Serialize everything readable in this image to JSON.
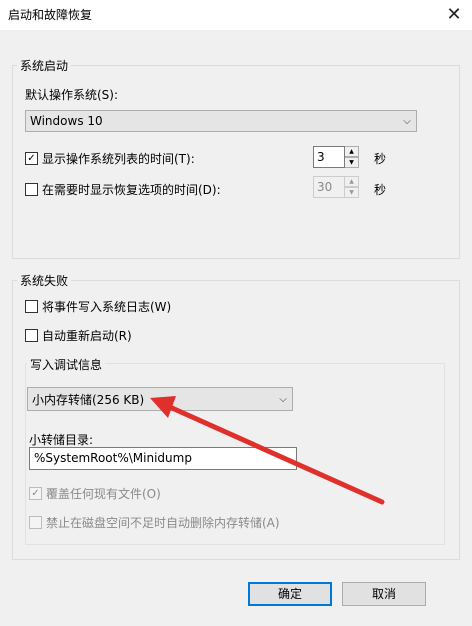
{
  "window": {
    "title": "启动和故障恢复",
    "close_glyph": "✕"
  },
  "system_startup": {
    "legend": "系统启动",
    "default_os_label": "默认操作系统(S):",
    "default_os_value": "Windows 10",
    "show_os_list": {
      "label": "显示操作系统列表的时间(T):",
      "checked": true,
      "value": "3",
      "unit": "秒"
    },
    "show_recovery": {
      "label": "在需要时显示恢复选项的时间(D):",
      "checked": false,
      "value": "30",
      "unit": "秒"
    }
  },
  "system_failure": {
    "legend": "系统失败",
    "write_event_log": {
      "label": "将事件写入系统日志(W)",
      "checked": false
    },
    "auto_restart": {
      "label": "自动重新启动(R)",
      "checked": false
    },
    "debug_info": {
      "legend": "写入调试信息",
      "dump_type": "小内存转储(256 KB)",
      "dump_dir_label": "小转储目录:",
      "dump_dir_value": "%SystemRoot%\\Minidump",
      "overwrite": {
        "label": "覆盖任何现有文件(O)",
        "checked": true
      },
      "disable_auto_delete": {
        "label": "禁止在磁盘空间不足时自动删除内存转储(A)",
        "checked": false
      }
    }
  },
  "buttons": {
    "ok": "确定",
    "cancel": "取消"
  },
  "glyphs": {
    "check": "✓",
    "combo_arrow": "⌵",
    "spin_up": "▲",
    "spin_down": "▼"
  },
  "annotation_color": "#e0302c"
}
